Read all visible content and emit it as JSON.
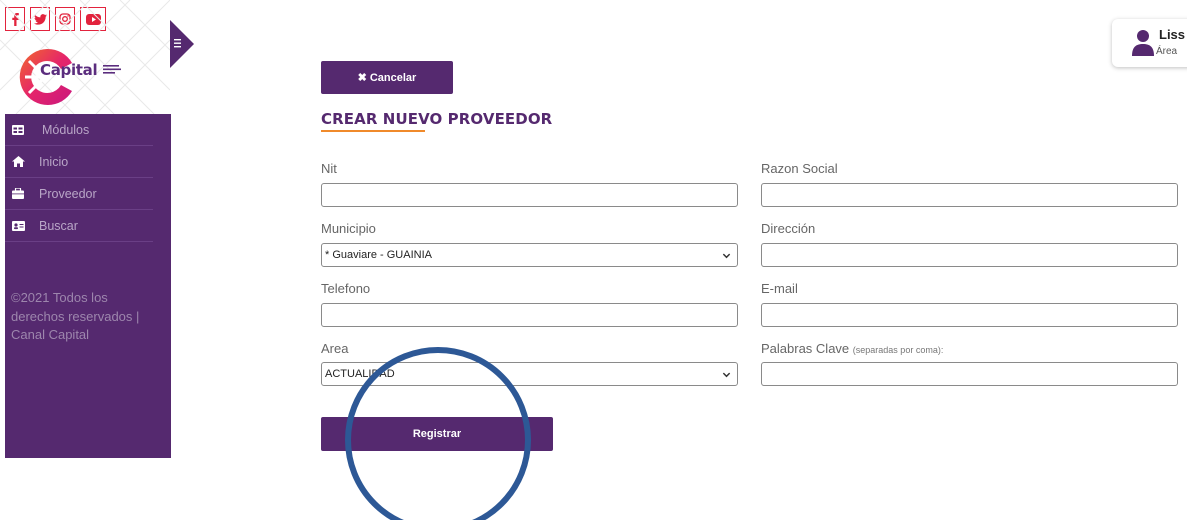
{
  "social": [
    {
      "icon": "facebook-icon",
      "glyph": "f"
    },
    {
      "icon": "twitter-icon",
      "glyph": ""
    },
    {
      "icon": "instagram-icon",
      "glyph": ""
    },
    {
      "icon": "youtube-icon",
      "glyph": ""
    }
  ],
  "brand": {
    "name": "Capital"
  },
  "sidebar": {
    "items": [
      {
        "label": "Módulos",
        "icon": "modules-icon"
      },
      {
        "label": "Inicio",
        "icon": "home-icon"
      },
      {
        "label": "Proveedor",
        "icon": "briefcase-icon"
      },
      {
        "label": "Buscar",
        "icon": "id-card-icon"
      }
    ],
    "footer": "©2021 Todos los derechos reservados | Canal Capital"
  },
  "user": {
    "name": "Liss",
    "role": "Área"
  },
  "actions": {
    "cancel_label": "Cancelar",
    "register_label": "Registrar"
  },
  "page": {
    "title": "CREAR NUEVO PROVEEDOR"
  },
  "form": {
    "nit": {
      "label": "Nit",
      "value": ""
    },
    "razon_social": {
      "label": "Razon Social",
      "value": ""
    },
    "municipio": {
      "label": "Municipio",
      "value": "* Guaviare - GUAINIA"
    },
    "direccion": {
      "label": "Dirección",
      "value": ""
    },
    "telefono": {
      "label": "Telefono",
      "value": ""
    },
    "email": {
      "label": "E-mail",
      "value": ""
    },
    "area": {
      "label": "Area",
      "value": "ACTUALIDAD"
    },
    "palabras_clave": {
      "label": "Palabras Clave",
      "hint": "(separadas por coma):",
      "value": ""
    }
  },
  "colors": {
    "primary": "#55296f",
    "accent": "#f08a2b",
    "social": "#e2233d",
    "highlight": "#2d5896"
  }
}
